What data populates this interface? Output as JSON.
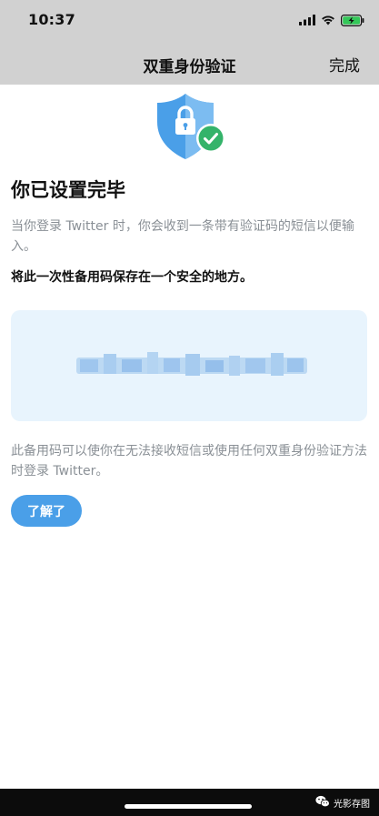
{
  "status_bar": {
    "time": "10:37"
  },
  "nav": {
    "title": "双重身份验证",
    "done_label": "完成"
  },
  "content": {
    "title": "你已设置完毕",
    "intro": "当你登录 Twitter 时，你会收到一条带有验证码的短信以便输入。",
    "instruction": "将此一次性备用码保存在一个安全的地方。",
    "footer": "此备用码可以使你在无法接收短信或使用任何双重身份验证方法时登录 Twitter。",
    "button_label": "了解了"
  },
  "icons": {
    "shield": "shield-lock-check-icon",
    "signal": "cellular-signal-icon",
    "wifi": "wifi-icon",
    "battery": "battery-charging-icon",
    "watermark": "wechat-icon"
  },
  "colors": {
    "accent": "#4a9fe8",
    "code_box_bg": "#e8f4fd",
    "check_green": "#34b36a",
    "shield_blue": "#4a9fe8",
    "muted_text": "#8a9096"
  },
  "watermark": {
    "text": "光影存图"
  }
}
